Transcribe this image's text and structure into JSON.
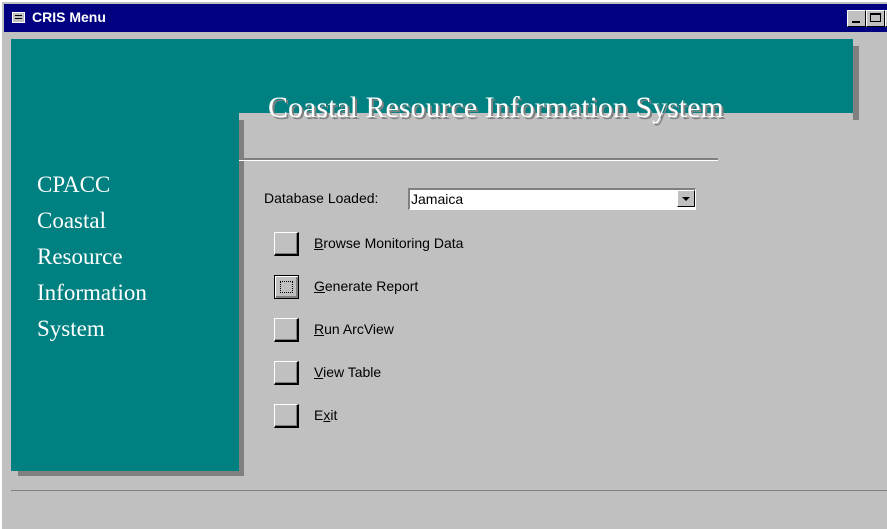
{
  "window": {
    "title": "CRIS Menu"
  },
  "header": {
    "app_title": "Coastal Resource Information System"
  },
  "sidebar": {
    "lines": [
      "CPACC",
      "Coastal",
      "Resource",
      "Information",
      "System"
    ]
  },
  "database": {
    "label": "Database Loaded:",
    "value": "Jamaica"
  },
  "menu": [
    {
      "label_pre": "",
      "mnemonic": "B",
      "label_post": "rowse Monitoring Data"
    },
    {
      "label_pre": "",
      "mnemonic": "G",
      "label_post": "enerate Report"
    },
    {
      "label_pre": "",
      "mnemonic": "R",
      "label_post": "un ArcView"
    },
    {
      "label_pre": "",
      "mnemonic": "V",
      "label_post": "iew Table"
    },
    {
      "label_pre": "E",
      "mnemonic": "x",
      "label_post": "it"
    }
  ],
  "colors": {
    "title_bar": "#000080",
    "panel": "#008080",
    "background": "#c0c0c0"
  }
}
